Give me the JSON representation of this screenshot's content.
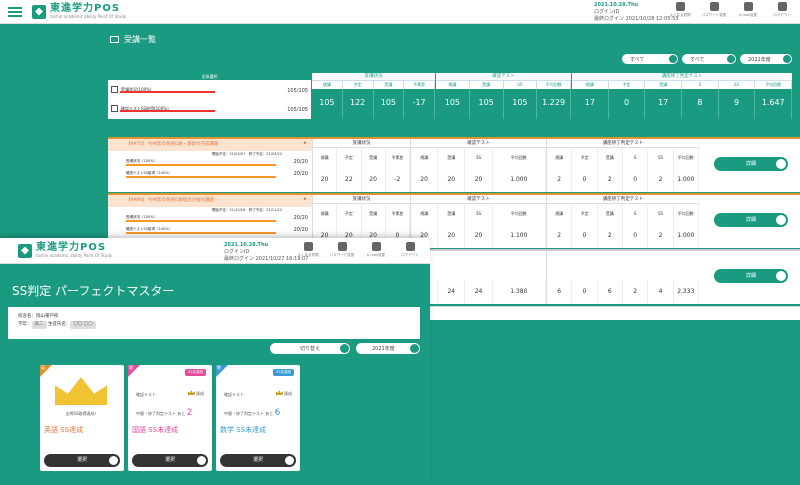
{
  "back": {
    "header": {
      "logo_title": "東進学力POS",
      "logo_sub": "toshin academic ability Point Of Study",
      "date": "2021.10.28.Thu",
      "login_id": "ログインID",
      "last_login": "最終ログイン 2021/10/28 12:05:53",
      "icons": [
        {
          "label": "よくある質問",
          "icon": "chat-icon"
        },
        {
          "label": "パスワード変更",
          "icon": "key-icon"
        },
        {
          "label": "e-mail変更",
          "icon": "mail-icon"
        },
        {
          "label": "ログアウト",
          "icon": "lock-icon"
        }
      ]
    },
    "title": "受講一覧",
    "selects": [
      "すべて",
      "すべて",
      "2021年度"
    ],
    "summary": {
      "all_select": "全体選択",
      "rows": [
        {
          "label": "受講状況(100%)",
          "value": "105/105"
        },
        {
          "label": "確認テストSS取得(100%)",
          "value": "105/105"
        }
      ],
      "groups": [
        {
          "title": "受講状況",
          "cols": [
            "規講",
            "予定",
            "受講",
            "予実差"
          ],
          "vals": [
            "105",
            "122",
            "105",
            "-17"
          ]
        },
        {
          "title": "確認テスト",
          "cols": [
            "規講",
            "受講",
            "SS",
            "平均回数"
          ],
          "vals": [
            "105",
            "105",
            "105",
            "1.229"
          ]
        },
        {
          "title": "講座修了判定テスト",
          "cols": [
            "規講",
            "予定",
            "受講",
            "S",
            "SS",
            "平均回数"
          ],
          "vals": [
            "17",
            "0",
            "17",
            "8",
            "9",
            "1.647"
          ]
        }
      ]
    },
    "rows": [
      {
        "title": "【9975】 今井宏の英語C組・基礎力完成講座",
        "line1": "受講状況（100%）",
        "line1_meta": "開始予定：21/03/07　修了予定：21/03/22",
        "line1_val": "20/20",
        "line2": "確認テストSS取得（100%）",
        "line2_val": "20/20",
        "groups": [
          {
            "title": "受講状況",
            "cols": [
              "規講",
              "予定",
              "受講",
              "予実差"
            ],
            "vals": [
              "20",
              "22",
              "20",
              "-2"
            ]
          },
          {
            "title": "確認テスト",
            "cols": [
              "規講",
              "受講",
              "SS",
              "平均回数"
            ],
            "vals": [
              "20",
              "20",
              "20",
              "1.000"
            ]
          },
          {
            "title": "講座修了判定テスト",
            "cols": [
              "規講",
              "予定",
              "受講",
              "S",
              "SS",
              "平均回数"
            ],
            "vals": [
              "2",
              "0",
              "2",
              "0",
              "2",
              "1.000"
            ]
          }
        ],
        "button": "詳細"
      },
      {
        "title": "【9989】 今井宏の英語C組総合力強化講座",
        "line1": "受講状況（100%）",
        "line1_meta": "開始予定：21/10/16　修了予定：21/11/22",
        "line1_val": "20/20",
        "line2": "確認テストSS取得（100%）",
        "line2_val": "20/20",
        "groups": [
          {
            "title": "受講状況",
            "cols": [
              "規講",
              "予定",
              "受講",
              "予実差"
            ],
            "vals": [
              "20",
              "20",
              "20",
              "0"
            ]
          },
          {
            "title": "確認テスト",
            "cols": [
              "規講",
              "受講",
              "SS",
              "平均回数"
            ],
            "vals": [
              "20",
              "20",
              "20",
              "1.100"
            ]
          },
          {
            "title": "講座修了判定テスト",
            "cols": [
              "規講",
              "予定",
              "受講",
              "S",
              "SS",
              "平均回数"
            ],
            "vals": [
              "2",
              "0",
              "2",
              "0",
              "2",
              "1.000"
            ]
          }
        ],
        "button": "詳細"
      },
      {
        "partial": true,
        "vals1": [
          "24",
          "24",
          "24",
          "1.380"
        ],
        "vals2": [
          "6",
          "0",
          "6",
          "2",
          "4",
          "2.333"
        ],
        "button": "詳細"
      }
    ]
  },
  "front": {
    "header": {
      "logo_title": "東進学力POS",
      "logo_sub": "toshin academic ability Point Of Study",
      "date": "2021.10.28.Thu",
      "login_id": "ログインID",
      "last_login": "最終ログイン 2021/10/27 16:19:07",
      "icons": [
        {
          "label": "よくある質問",
          "icon": "chat-icon"
        },
        {
          "label": "パスワード変更",
          "icon": "key-icon"
        },
        {
          "label": "e-mail変更",
          "icon": "mail-icon"
        },
        {
          "label": "ログアウト",
          "icon": "lock-icon"
        }
      ]
    },
    "title": "SS判定 パーフェクトマスター",
    "student": {
      "school_label": "校舎名：",
      "school": "岡山東戸校",
      "grade_label": "学年：",
      "grade": "高二",
      "name_label": "生徒氏名：",
      "name": "〇〇 〇〇"
    },
    "switch_button": "切り替え",
    "year_select": "2021年度",
    "cards": [
      {
        "corner": "英",
        "all_ss": "全問SS取得達成！",
        "result": "英語 SS達成",
        "button": "選択"
      },
      {
        "corner": "国",
        "badge": "SS未達成",
        "test_label": "確認テスト",
        "test_status": "達成",
        "exam_label": "中間・修了判定テスト あと",
        "remain": "2",
        "result": "国語 SS未達成",
        "button": "選択"
      },
      {
        "corner": "数",
        "badge": "SS未達成",
        "test_label": "確認テスト",
        "test_status": "達成",
        "exam_label": "中間・修了判定テスト あと",
        "remain": "6",
        "result": "数学 SS未達成",
        "button": "選択"
      }
    ]
  },
  "colors": {
    "brand": "#1a9b81",
    "orange": "#e8763a",
    "pink": "#e44d9a",
    "blue": "#3a9ad9",
    "gold": "#f1c232"
  }
}
